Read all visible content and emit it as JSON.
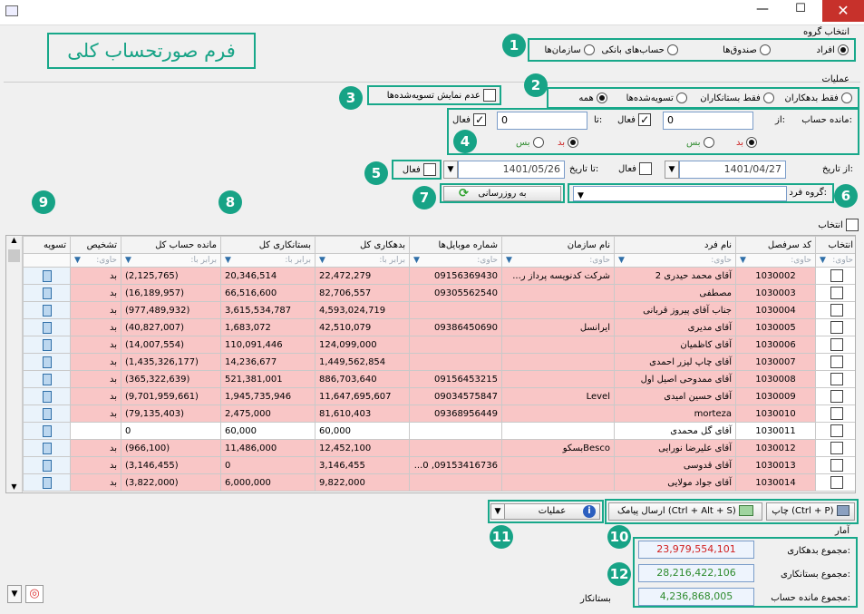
{
  "window": {
    "close_glyph": "✕",
    "minimize_glyph": "—",
    "maximize_glyph": "☐"
  },
  "form_title": "فرم صورتحساب کلی",
  "group_select": {
    "title": "انتخاب گروه",
    "options": [
      "افراد",
      "صندوق‌ها",
      "حساب‌های بانکی",
      "سازمان‌ها"
    ],
    "selected": 0
  },
  "operations": {
    "title": "عملیات",
    "filter_options": [
      "فقط بدهکاران",
      "فقط بستانکاران",
      "تسویه‌شده‌ها",
      "همه"
    ],
    "selected": 3,
    "hide_settled_label": "عدم نمایش تسویه‌شده‌ها"
  },
  "balance": {
    "label": "مانده حساب:",
    "from_label": "از:",
    "to_label": "تا:",
    "from_value": "0",
    "to_value": "0",
    "active_label": "فعال",
    "debit_label": "بد",
    "credit_label": "بس"
  },
  "dates": {
    "from_label": "از تاریخ:",
    "to_label": "تا تاریخ:",
    "from_value": "1401/04/27",
    "to_value": "1401/05/26",
    "active_label": "فعال"
  },
  "person_group_label": "گروه فرد:",
  "refresh_label": "به روزرسانی",
  "select_all_label": "انتخاب",
  "badges": [
    "1",
    "2",
    "3",
    "4",
    "5",
    "6",
    "7",
    "8",
    "9",
    "10",
    "11",
    "12"
  ],
  "grid": {
    "columns": [
      "انتخاب",
      "کد سرفصل",
      "نام فرد",
      "نام سازمان",
      "شماره موبایل‌ها",
      "بدهکاری کل",
      "بستانکاری کل",
      "مانده حساب کل",
      "تشخیص",
      "تسویه"
    ],
    "filters": [
      "حاوی:",
      "حاوی:",
      "حاوی:",
      "حاوی:",
      "حاوی:",
      "برابر با:",
      "برابر با:",
      "برابر با:",
      "حاوی:",
      ""
    ],
    "rows": [
      {
        "code": "1030002",
        "name": "آقای محمد حیدری 2",
        "org": "شرکت کدنویسه پرداز ر...",
        "mobile": "09156369430",
        "debit": "22,472,279",
        "credit": "20,346,514",
        "balance": "(2,125,765)",
        "diag": "بد",
        "white": false
      },
      {
        "code": "1030003",
        "name": "مصطفی",
        "org": "",
        "mobile": "09305562540",
        "debit": "82,706,557",
        "credit": "66,516,600",
        "balance": "(16,189,957)",
        "diag": "بد",
        "white": false
      },
      {
        "code": "1030004",
        "name": "جناب آقای پیروز قربانی",
        "org": "",
        "mobile": "",
        "debit": "4,593,024,719",
        "credit": "3,615,534,787",
        "balance": "(977,489,932)",
        "diag": "بد",
        "white": false
      },
      {
        "code": "1030005",
        "name": "آقای مدیری",
        "org": "ایرانسل",
        "mobile": "09386450690",
        "debit": "42,510,079",
        "credit": "1,683,072",
        "balance": "(40,827,007)",
        "diag": "بد",
        "white": false
      },
      {
        "code": "1030006",
        "name": "آقای کاظمیان",
        "org": "",
        "mobile": "",
        "debit": "124,099,000",
        "credit": "110,091,446",
        "balance": "(14,007,554)",
        "diag": "بد",
        "white": false
      },
      {
        "code": "1030007",
        "name": "آقای چاپ لیزر احمدی",
        "org": "",
        "mobile": "",
        "debit": "1,449,562,854",
        "credit": "14,236,677",
        "balance": "(1,435,326,177)",
        "diag": "بد",
        "white": false
      },
      {
        "code": "1030008",
        "name": "آقای ممدوحی اصیل اول",
        "org": "",
        "mobile": "09156453215",
        "debit": "886,703,640",
        "credit": "521,381,001",
        "balance": "(365,322,639)",
        "diag": "بد",
        "white": false
      },
      {
        "code": "1030009",
        "name": "آقای حسین امیدی",
        "org": "Level",
        "mobile": "09034575847",
        "debit": "11,647,695,607",
        "credit": "1,945,735,946",
        "balance": "(9,701,959,661)",
        "diag": "بد",
        "white": false
      },
      {
        "code": "1030010",
        "name": "morteza",
        "org": "",
        "mobile": "09368956449",
        "debit": "81,610,403",
        "credit": "2,475,000",
        "balance": "(79,135,403)",
        "diag": "بد",
        "white": false
      },
      {
        "code": "1030011",
        "name": "آقای گل محمدی",
        "org": "",
        "mobile": "",
        "debit": "60,000",
        "credit": "60,000",
        "balance": "0",
        "diag": "",
        "white": true
      },
      {
        "code": "1030012",
        "name": "آقای علیرضا نورایی",
        "org": "Bescoبسکو",
        "mobile": "",
        "debit": "12,452,100",
        "credit": "11,486,000",
        "balance": "(966,100)",
        "diag": "بد",
        "white": false
      },
      {
        "code": "1030013",
        "name": "آقای قدوسی",
        "org": "",
        "mobile": "09153416736, 0...",
        "debit": "3,146,455",
        "credit": "0",
        "balance": "(3,146,455)",
        "diag": "بد",
        "white": false
      },
      {
        "code": "1030014",
        "name": "آقای جواد مولایی",
        "org": "",
        "mobile": "",
        "debit": "9,822,000",
        "credit": "6,000,000",
        "balance": "(3,822,000)",
        "diag": "بد",
        "white": false
      }
    ]
  },
  "toolbar": {
    "print_label": "(Ctrl + P) چاپ",
    "sms_label": "(Ctrl + Alt + S) ارسال پیامک",
    "ops_label": "عملیات"
  },
  "stats": {
    "title": "آمار",
    "total_debit_label": "مجموع بدهکاری:",
    "total_credit_label": "مجموع بستانکاری:",
    "total_balance_label": "مجموع مانده حساب:",
    "total_debit": "23,979,554,101",
    "total_credit": "28,216,422,106",
    "total_balance": "4,236,868,005",
    "balance_type": "بستانکار",
    "debit_color": "#d11f1f",
    "credit_color": "#2e8b2e"
  }
}
